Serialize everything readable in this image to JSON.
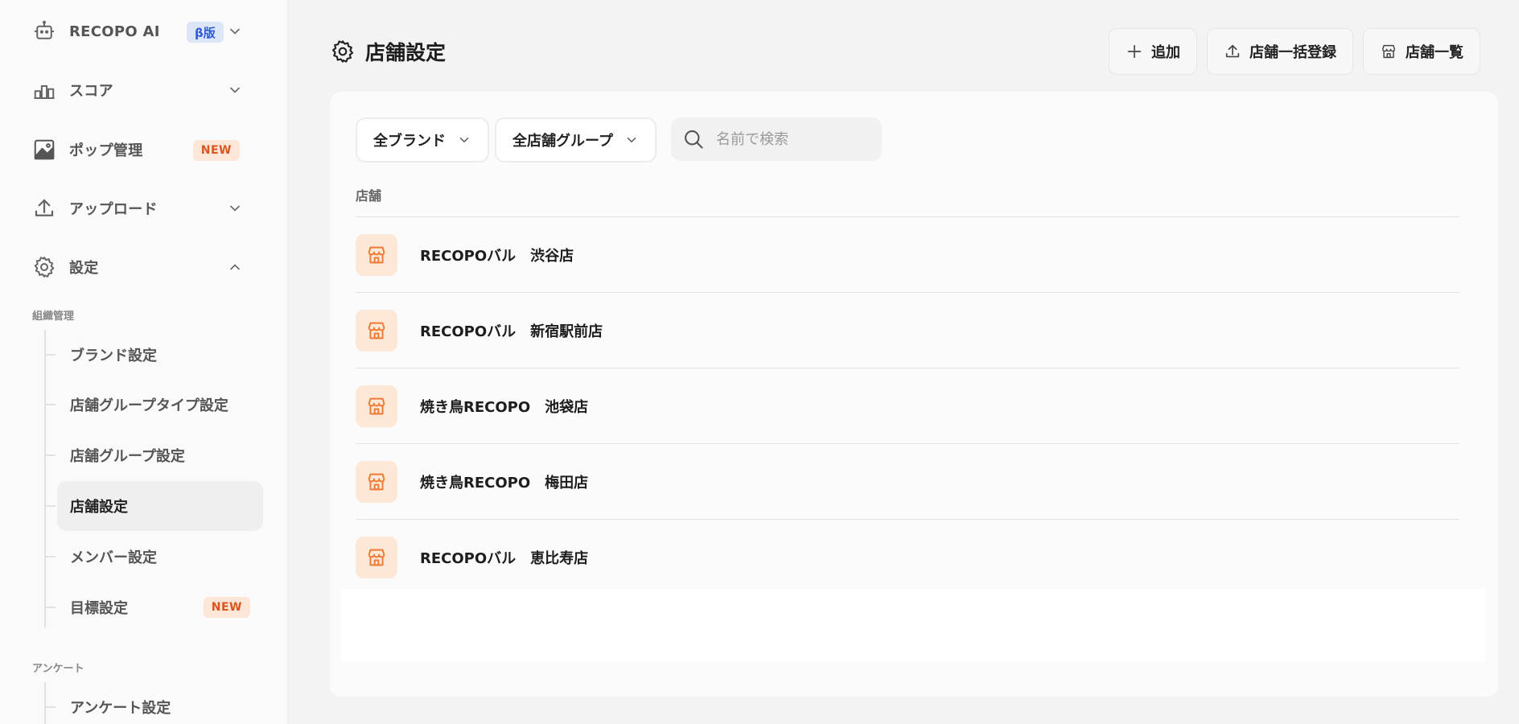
{
  "sidebar": {
    "items": [
      {
        "label": "RECOPO AI",
        "icon": "robot-icon",
        "badge": "β版"
      },
      {
        "label": "スコア",
        "icon": "bar-chart-icon"
      },
      {
        "label": "ポップ管理",
        "icon": "image-icon",
        "badge": "NEW"
      },
      {
        "label": "アップロード",
        "icon": "upload-icon"
      },
      {
        "label": "設定",
        "icon": "gear-icon"
      }
    ],
    "sections": [
      {
        "title": "組織管理",
        "items": [
          {
            "label": "ブランド設定"
          },
          {
            "label": "店舗グループタイプ設定"
          },
          {
            "label": "店舗グループ設定"
          },
          {
            "label": "店舗設定",
            "active": true
          },
          {
            "label": "メンバー設定"
          },
          {
            "label": "目標設定",
            "badge": "NEW"
          }
        ]
      },
      {
        "title": "アンケート",
        "items": [
          {
            "label": "アンケート設定"
          }
        ]
      }
    ]
  },
  "header": {
    "title": "店舗設定",
    "icon": "gear-icon",
    "buttons": {
      "add": "追加",
      "bulk_register": "店舗一括登録",
      "store_list": "店舗一覧"
    }
  },
  "filters": {
    "brand": "全ブランド",
    "group": "全店舗グループ",
    "search_placeholder": "名前で検索"
  },
  "table": {
    "column_header": "店舗",
    "rows": [
      {
        "name": "RECOPOバル　渋谷店"
      },
      {
        "name": "RECOPOバル　新宿駅前店"
      },
      {
        "name": "焼き鳥RECOPO　池袋店"
      },
      {
        "name": "焼き鳥RECOPO　梅田店"
      },
      {
        "name": "RECOPOバル　恵比寿店"
      }
    ]
  },
  "colors": {
    "accent_orange": "#ef7b34",
    "store_icon_bg": "#fde7d6",
    "beta_badge_bg": "#dde6f7",
    "beta_badge_text": "#2f5bd6",
    "new_badge_bg": "#fde6d8",
    "new_badge_text": "#d9561e"
  }
}
